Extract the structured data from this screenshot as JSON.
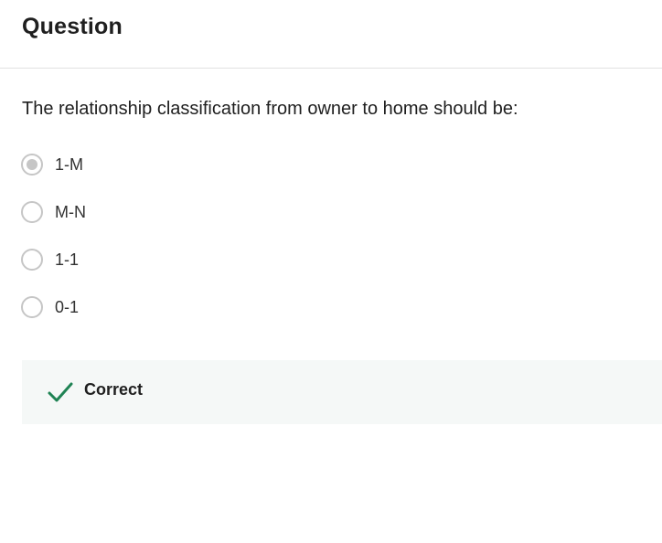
{
  "header": {
    "title": "Question"
  },
  "question": {
    "text": "The relationship classification from owner to home should be:"
  },
  "options": [
    {
      "label": "1-M",
      "selected": true
    },
    {
      "label": "M-N",
      "selected": false
    },
    {
      "label": "1-1",
      "selected": false
    },
    {
      "label": "0-1",
      "selected": false
    }
  ],
  "feedback": {
    "label": "Correct",
    "icon": "check-icon",
    "color": "#1f8354"
  },
  "colors": {
    "radio_border": "#c6c6c6",
    "feedback_bg": "#f5f8f7"
  }
}
